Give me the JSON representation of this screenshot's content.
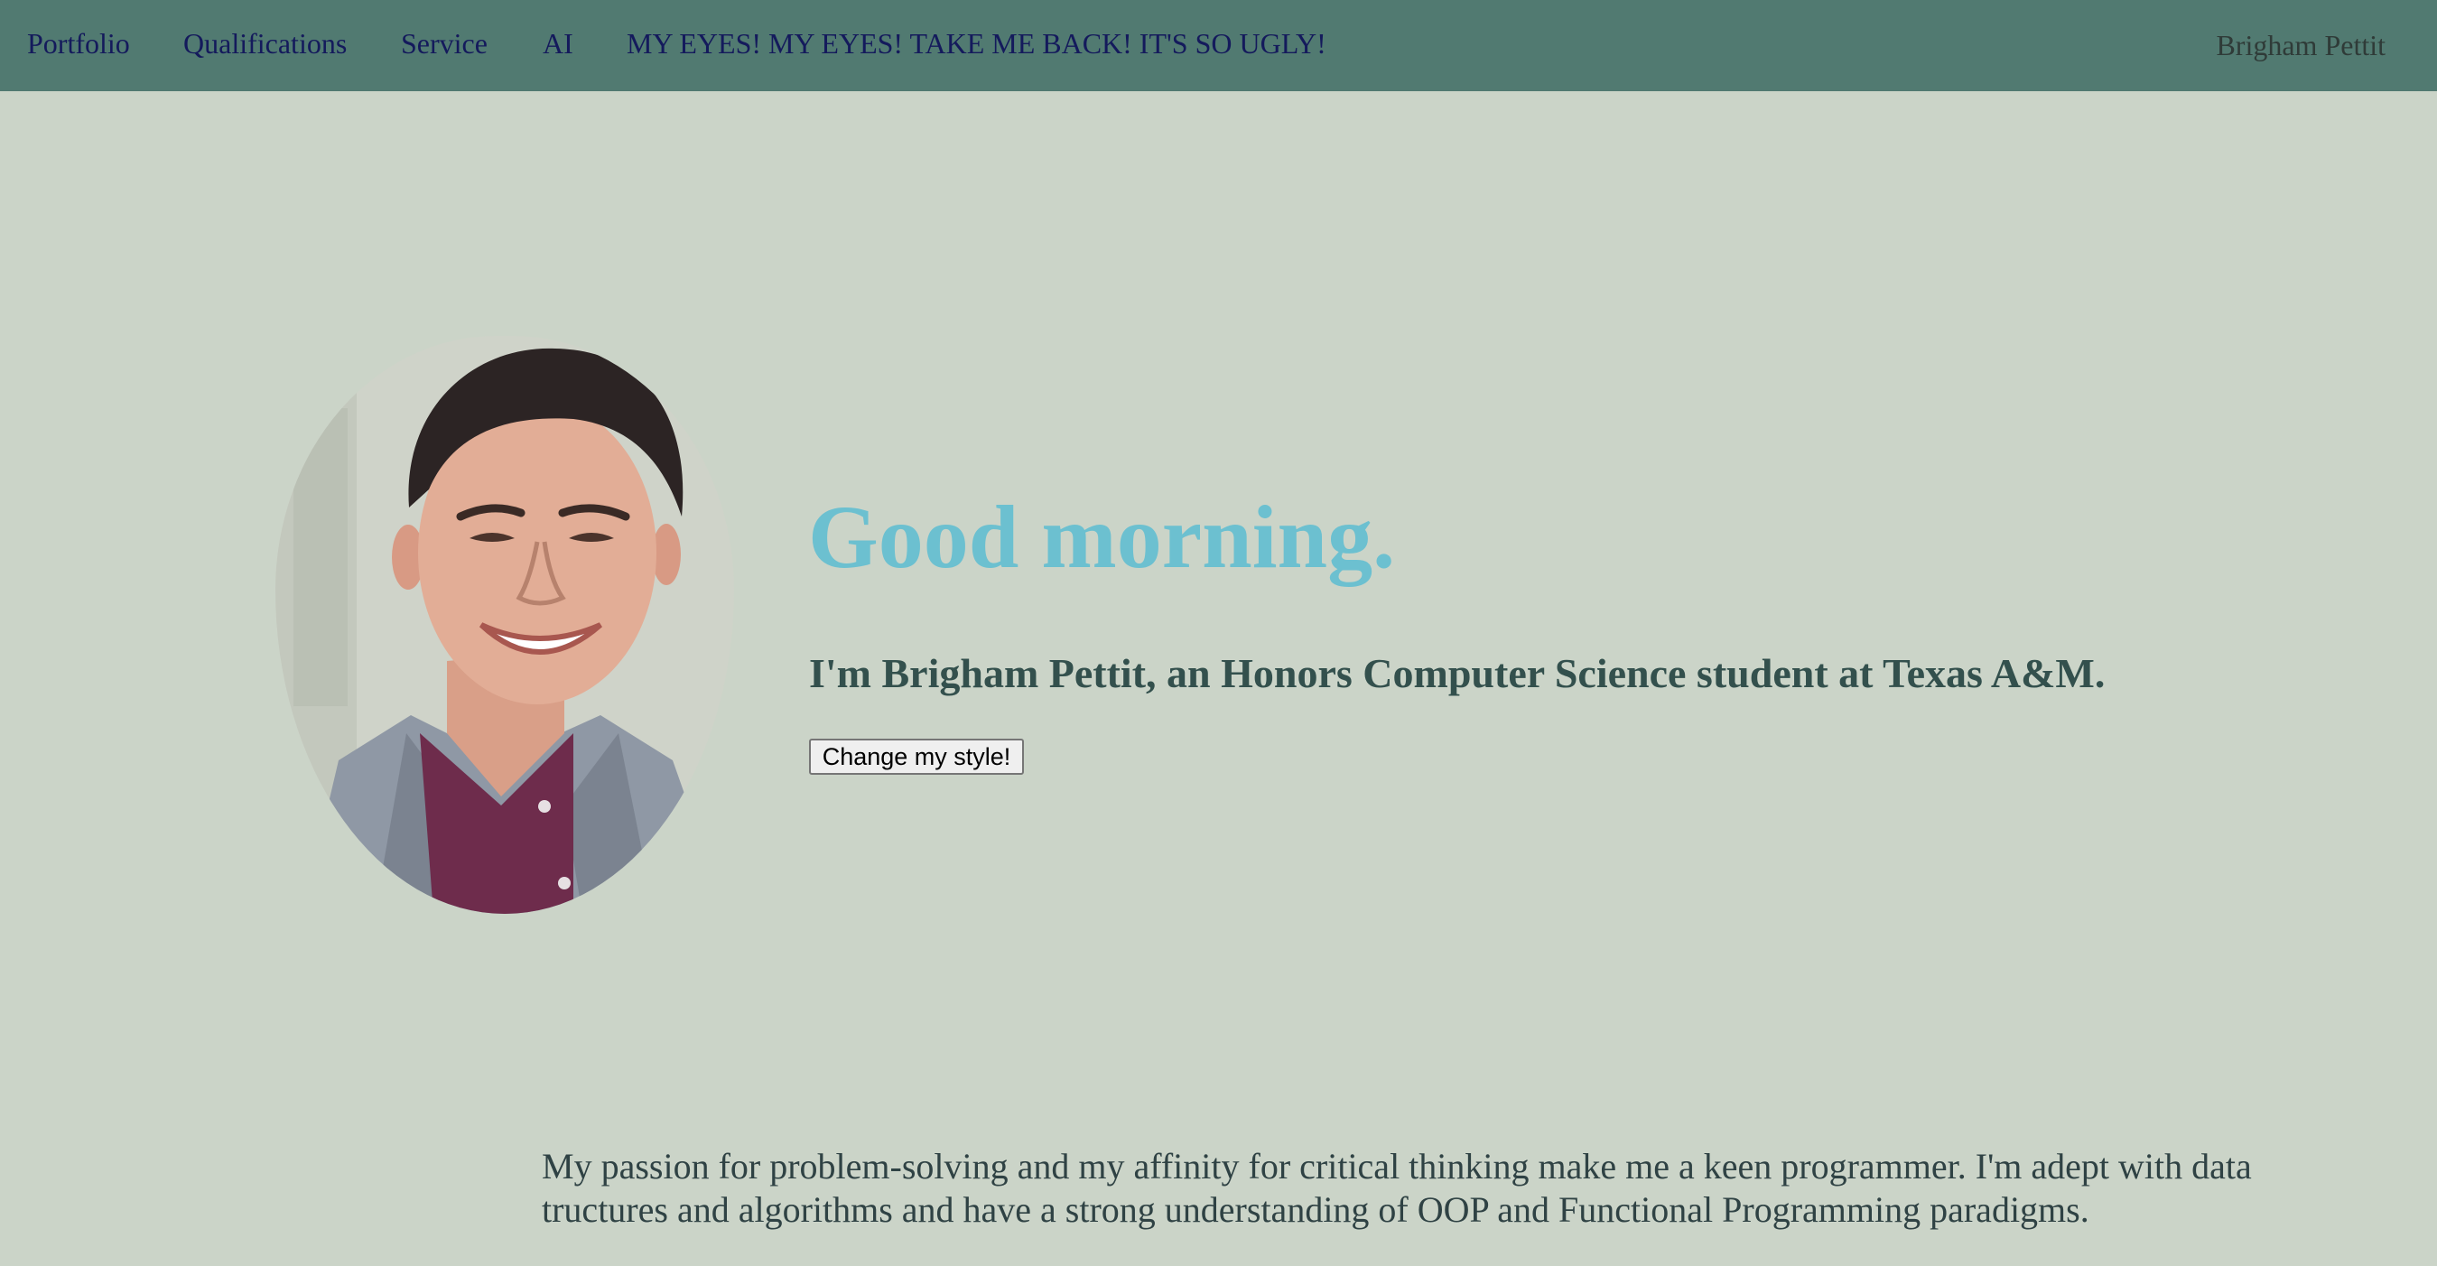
{
  "nav": {
    "links": [
      {
        "label": "Portfolio"
      },
      {
        "label": "Qualifications"
      },
      {
        "label": "Service"
      },
      {
        "label": "AI"
      },
      {
        "label": "MY EYES! MY EYES! TAKE ME BACK! IT'S SO UGLY!"
      }
    ],
    "brand": "Brigham Pettit"
  },
  "hero": {
    "greeting": "Good morning.",
    "intro": "I'm Brigham Pettit, an Honors Computer Science student at Texas A&M.",
    "button_label": "Change my style!",
    "photo_icon": "profile-photo"
  },
  "about": {
    "text": "My passion for problem-solving and my affinity for critical thinking make me a keen programmer. I'm adept with data tructures and algorithms and have a strong understanding of OOP and Functional Programming paradigms."
  },
  "colors": {
    "nav_background": "#517a71",
    "page_background": "#cbd4c8",
    "greeting": "#6cc0d0",
    "nav_link": "#141a5c"
  }
}
